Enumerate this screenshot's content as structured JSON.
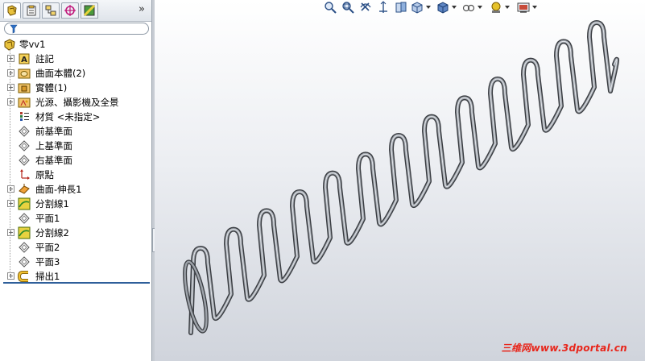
{
  "feature_tree": {
    "tabs": [
      {
        "icon": "feature-manager-icon"
      },
      {
        "icon": "property-manager-icon"
      },
      {
        "icon": "configuration-manager-icon"
      },
      {
        "icon": "dimxpert-manager-icon"
      },
      {
        "icon": "display-manager-icon"
      }
    ],
    "expand_label": "»",
    "root_label": "零vv1",
    "items": [
      {
        "label": "註記",
        "icon": "annotations-icon",
        "expandable": true
      },
      {
        "label": "曲面本體(2)",
        "icon": "surface-bodies-icon",
        "expandable": true
      },
      {
        "label": "實體(1)",
        "icon": "solid-bodies-icon",
        "expandable": true
      },
      {
        "label": "光源、攝影機及全景",
        "icon": "lights-cameras-scene-icon",
        "expandable": true
      },
      {
        "label": "材質 <未指定>",
        "icon": "material-icon",
        "expandable": false
      },
      {
        "label": "前基準面",
        "icon": "plane-icon",
        "expandable": false
      },
      {
        "label": "上基準面",
        "icon": "plane-icon",
        "expandable": false
      },
      {
        "label": "右基準面",
        "icon": "plane-icon",
        "expandable": false
      },
      {
        "label": "原點",
        "icon": "origin-icon",
        "expandable": false
      },
      {
        "label": "曲面-伸長1",
        "icon": "surface-extrude-icon",
        "expandable": true
      },
      {
        "label": "分割線1",
        "icon": "split-line-icon",
        "expandable": true
      },
      {
        "label": "平面1",
        "icon": "plane-icon",
        "expandable": false
      },
      {
        "label": "分割線2",
        "icon": "split-line-icon",
        "expandable": true
      },
      {
        "label": "平面2",
        "icon": "plane-icon",
        "expandable": false
      },
      {
        "label": "平面3",
        "icon": "plane-icon",
        "expandable": false
      },
      {
        "label": "掃出1",
        "icon": "sweep-icon",
        "expandable": true
      }
    ]
  },
  "view_toolbar": [
    "zoom-to-fit-icon",
    "zoom-to-area-icon",
    "previous-view-icon",
    "section-view-icon",
    "dynamic-annotation-views-icon",
    "view-orientation-icon",
    "display-style-icon",
    "hide-show-items-icon",
    "edit-appearance-icon",
    "apply-scene-icon"
  ],
  "watermark": "三维网www.3dportal.cn",
  "colors": {
    "tree_background": "#ffffff",
    "tree_end_line": "#2f5f9a",
    "spring_stroke": "#3a3d42",
    "spring_fill": "#9ea3aa",
    "watermark": "#e8251a"
  }
}
